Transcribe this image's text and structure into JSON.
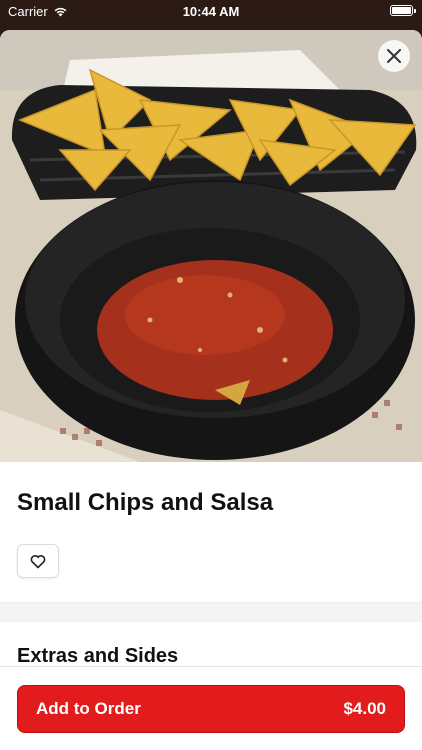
{
  "status_bar": {
    "carrier": "Carrier",
    "time": "10:44 AM",
    "battery_level": 1.0
  },
  "item": {
    "name": "Small Chips and Salsa",
    "image_subject": "chips-basket-and-salsa-bowl",
    "close_icon": "close-icon",
    "favorite_icon": "heart-outline-icon"
  },
  "sections": {
    "extras_title": "Extras and Sides"
  },
  "order": {
    "button_label": "Add to Order",
    "price": "$4.00"
  },
  "colors": {
    "accent": "#e21c1c",
    "sheet_background": "#ffffff",
    "band": "#f4f4f4"
  }
}
